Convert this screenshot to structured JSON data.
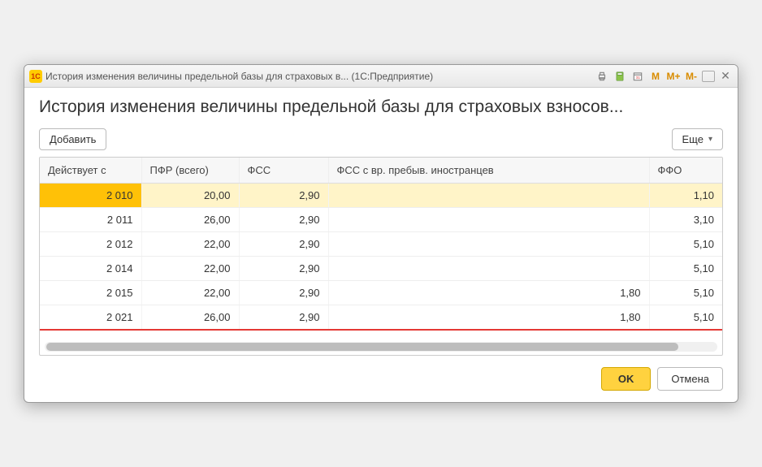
{
  "titlebar": {
    "app_icon_text": "1C",
    "title": "История изменения величины предельной базы для страховых в... (1С:Предприятие)"
  },
  "page_title": "История изменения величины предельной базы для страховых взносов...",
  "toolbar": {
    "add_label": "Добавить",
    "more_label": "Еще"
  },
  "columns": {
    "date": "Действует с",
    "pfr": "ПФР (всего)",
    "fss": "ФСС",
    "fss_foreign": "ФСС с вр. пребыв. иностранцев",
    "ffo": "ФФО"
  },
  "rows": [
    {
      "date": "2 010",
      "pfr": "20,00",
      "fss": "2,90",
      "fss_foreign": "",
      "ffo": "1,10",
      "selected": true
    },
    {
      "date": "2 011",
      "pfr": "26,00",
      "fss": "2,90",
      "fss_foreign": "",
      "ffo": "3,10"
    },
    {
      "date": "2 012",
      "pfr": "22,00",
      "fss": "2,90",
      "fss_foreign": "",
      "ffo": "5,10"
    },
    {
      "date": "2 014",
      "pfr": "22,00",
      "fss": "2,90",
      "fss_foreign": "",
      "ffo": "5,10"
    },
    {
      "date": "2 015",
      "pfr": "22,00",
      "fss": "2,90",
      "fss_foreign": "1,80",
      "ffo": "5,10"
    },
    {
      "date": "2 021",
      "pfr": "26,00",
      "fss": "2,90",
      "fss_foreign": "1,80",
      "ffo": "5,10",
      "last": true
    }
  ],
  "footer": {
    "ok_label": "OK",
    "cancel_label": "Отмена"
  },
  "m_icons": {
    "m": "M",
    "mplus": "M+",
    "mminus": "M-"
  }
}
